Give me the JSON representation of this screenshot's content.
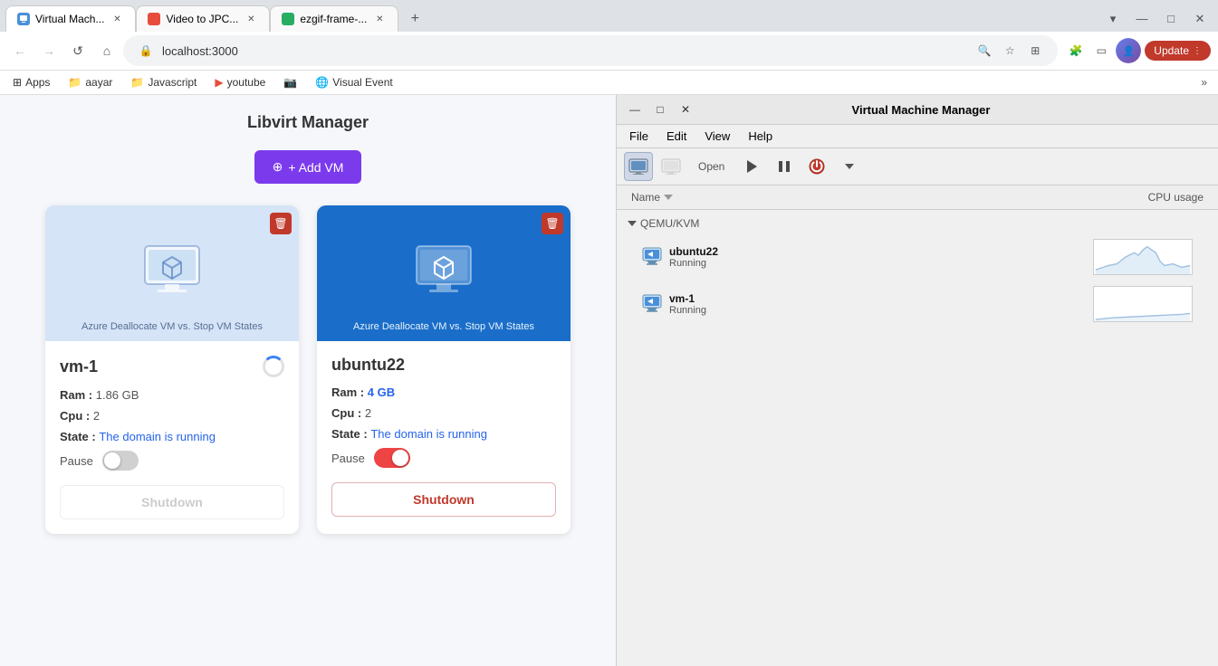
{
  "browser": {
    "tabs": [
      {
        "id": "tab1",
        "label": "Virtual Mach...",
        "url": "localhost:3000",
        "active": true,
        "favicon_color": "#4a90d9"
      },
      {
        "id": "tab2",
        "label": "Video to JPC...",
        "url": "",
        "active": false,
        "favicon_color": "#e74c3c"
      },
      {
        "id": "tab3",
        "label": "ezgif-frame-...",
        "url": "",
        "active": false,
        "favicon_color": "#27ae60"
      }
    ],
    "address": "localhost:3000",
    "update_btn": "Update",
    "bookmarks": [
      {
        "label": "Apps",
        "icon": "apps"
      },
      {
        "label": "aayar",
        "icon": "folder"
      },
      {
        "label": "Javascript",
        "icon": "folder"
      },
      {
        "label": "youtube",
        "icon": "youtube"
      },
      {
        "label": "Visual Event",
        "icon": "link"
      }
    ]
  },
  "page": {
    "title": "Libvirt Manager",
    "add_vm_label": "+ Add VM"
  },
  "vms": [
    {
      "id": "vm1",
      "name": "vm-1",
      "ram": "1.86 GB",
      "cpu": "2",
      "state": "The domain is running",
      "pause": false,
      "header_style": "light",
      "card_title": "Azure Deallocate VM vs. Stop VM States",
      "shutdown_label": "Shutdown",
      "shutdown_active": false
    },
    {
      "id": "vm2",
      "name": "ubuntu22",
      "ram": "4 GB",
      "cpu": "2",
      "state": "The domain is running",
      "pause": true,
      "header_style": "dark",
      "card_title": "Azure Deallocate VM vs. Stop VM States",
      "shutdown_label": "Shutdown",
      "shutdown_active": true
    }
  ],
  "vmm": {
    "title": "Virtual Machine Manager",
    "menus": [
      "File",
      "Edit",
      "View",
      "Help"
    ],
    "columns": {
      "name": "Name",
      "cpu": "CPU usage"
    },
    "group": "QEMU/KVM",
    "machines": [
      {
        "name": "ubuntu22",
        "status": "Running"
      },
      {
        "name": "vm-1",
        "status": "Running"
      }
    ],
    "open_btn": "Open",
    "win_buttons": [
      "—",
      "□",
      "✕"
    ]
  }
}
